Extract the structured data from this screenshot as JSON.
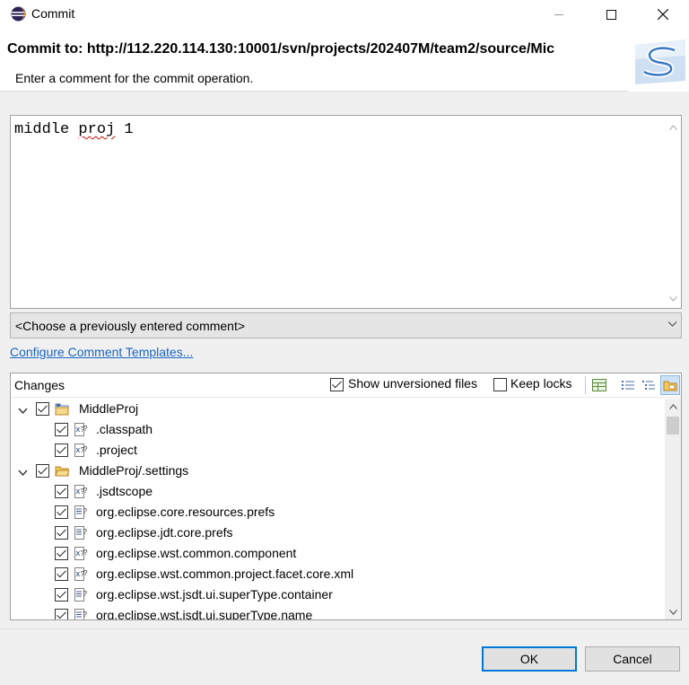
{
  "window": {
    "title": "Commit",
    "minimize_icon": "minimize-icon",
    "maximize_icon": "maximize-icon",
    "close_icon": "close-icon"
  },
  "header": {
    "title": "Commit to: http://112.220.114.130:10001/svn/projects/202407M/team2/source/Mic",
    "description": "Enter a comment for the commit operation.",
    "banner_icon": "svn-commit-banner-icon"
  },
  "comment": {
    "value_prefix": "middle ",
    "value_misspelled": "proj",
    "value_suffix": " 1"
  },
  "previous_comments": {
    "selected": "<Choose a previously entered comment>"
  },
  "configure_link": "Configure Comment Templates...",
  "changes": {
    "label": "Changes",
    "show_unversioned_label": "Show unversioned files",
    "show_unversioned_checked": true,
    "keep_locks_label": "Keep locks",
    "keep_locks_checked": false,
    "tree": [
      {
        "label": "MiddleProj",
        "level": 0,
        "expanded": true,
        "checked": true,
        "icon": "project-folder-icon"
      },
      {
        "label": ".classpath",
        "level": 1,
        "checked": true,
        "icon": "xml-file-icon"
      },
      {
        "label": ".project",
        "level": 1,
        "checked": true,
        "icon": "xml-file-icon"
      },
      {
        "label": "MiddleProj/.settings",
        "level": 0,
        "expanded": true,
        "checked": true,
        "icon": "folder-icon"
      },
      {
        "label": ".jsdtscope",
        "level": 1,
        "checked": true,
        "icon": "xml-file-icon"
      },
      {
        "label": "org.eclipse.core.resources.prefs",
        "level": 1,
        "checked": true,
        "icon": "text-file-icon"
      },
      {
        "label": "org.eclipse.jdt.core.prefs",
        "level": 1,
        "checked": true,
        "icon": "text-file-icon"
      },
      {
        "label": "org.eclipse.wst.common.component",
        "level": 1,
        "checked": true,
        "icon": "xml-file-icon"
      },
      {
        "label": "org.eclipse.wst.common.project.facet.core.xml",
        "level": 1,
        "checked": true,
        "icon": "xml-file-icon"
      },
      {
        "label": "org.eclipse.wst.jsdt.ui.superType.container",
        "level": 1,
        "checked": true,
        "icon": "text-file-icon"
      },
      {
        "label": "org.eclipse.wst.jsdt.ui.superType.name",
        "level": 1,
        "checked": true,
        "icon": "text-file-icon"
      }
    ]
  },
  "buttons": {
    "ok": "OK",
    "cancel": "Cancel"
  }
}
